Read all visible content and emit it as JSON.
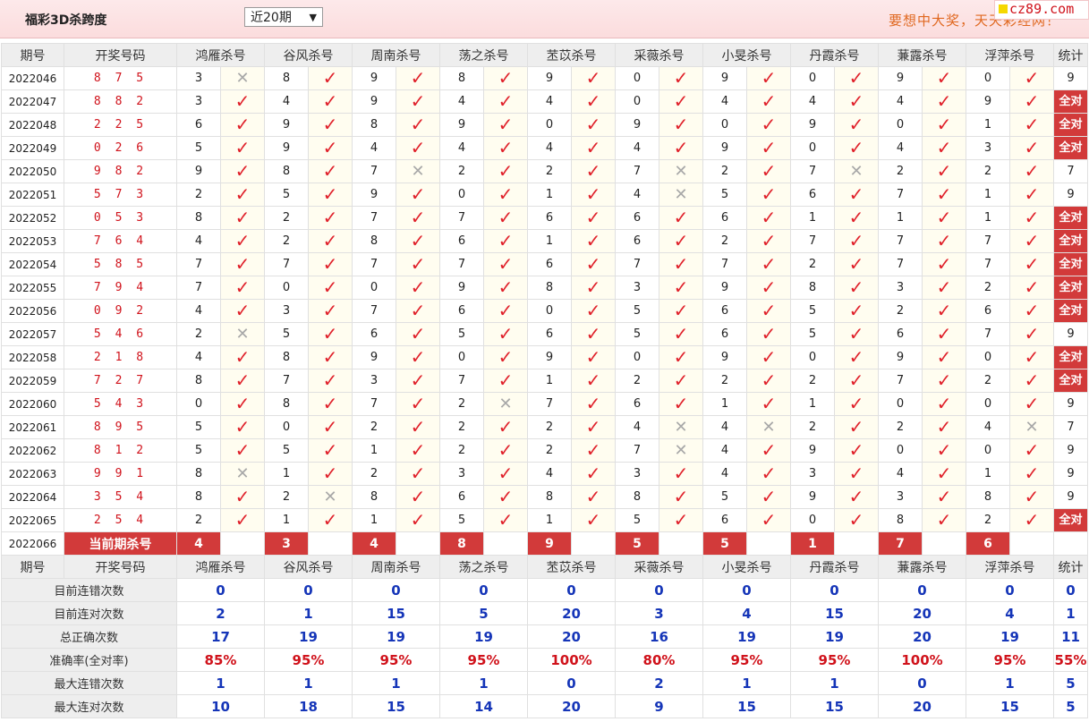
{
  "header": {
    "title": "福彩3D杀跨度",
    "period_select": "近20期",
    "dropdown_arrow": "▼",
    "slogan": "要想中大奖，天天彩经网！",
    "logo_text": "cz89.com"
  },
  "columns": {
    "issue": "期号",
    "draw": "开奖号码",
    "experts": [
      "鸿雁杀号",
      "谷风杀号",
      "周南杀号",
      "荡之杀号",
      "苤苡杀号",
      "采薇杀号",
      "小旻杀号",
      "丹霞杀号",
      "蒹露杀号",
      "浮萍杀号"
    ],
    "stat": "统计"
  },
  "marks": {
    "ok": "✓",
    "no": "✕",
    "all_ok": "全对"
  },
  "rows": [
    {
      "issue": "2022046",
      "draw": "8 7 5",
      "kills": [
        3,
        8,
        9,
        8,
        9,
        0,
        9,
        0,
        9,
        0
      ],
      "res": [
        0,
        1,
        1,
        1,
        1,
        1,
        1,
        1,
        1,
        1
      ],
      "stat": "9"
    },
    {
      "issue": "2022047",
      "draw": "8 8 2",
      "kills": [
        3,
        4,
        9,
        4,
        4,
        0,
        4,
        4,
        4,
        9
      ],
      "res": [
        1,
        1,
        1,
        1,
        1,
        1,
        1,
        1,
        1,
        1
      ],
      "stat": "全对"
    },
    {
      "issue": "2022048",
      "draw": "2 2 5",
      "kills": [
        6,
        9,
        8,
        9,
        0,
        9,
        0,
        9,
        0,
        1
      ],
      "res": [
        1,
        1,
        1,
        1,
        1,
        1,
        1,
        1,
        1,
        1
      ],
      "stat": "全对"
    },
    {
      "issue": "2022049",
      "draw": "0 2 6",
      "kills": [
        5,
        9,
        4,
        4,
        4,
        4,
        9,
        0,
        4,
        3
      ],
      "res": [
        1,
        1,
        1,
        1,
        1,
        1,
        1,
        1,
        1,
        1
      ],
      "stat": "全对"
    },
    {
      "issue": "2022050",
      "draw": "9 8 2",
      "kills": [
        9,
        8,
        7,
        2,
        2,
        7,
        2,
        7,
        2,
        2
      ],
      "res": [
        1,
        1,
        0,
        1,
        1,
        0,
        1,
        0,
        1,
        1
      ],
      "stat": "7"
    },
    {
      "issue": "2022051",
      "draw": "5 7 3",
      "kills": [
        2,
        5,
        9,
        0,
        1,
        4,
        5,
        6,
        7,
        1
      ],
      "res": [
        1,
        1,
        1,
        1,
        1,
        0,
        1,
        1,
        1,
        1
      ],
      "stat": "9"
    },
    {
      "issue": "2022052",
      "draw": "0 5 3",
      "kills": [
        8,
        2,
        7,
        7,
        6,
        6,
        6,
        1,
        1,
        1
      ],
      "res": [
        1,
        1,
        1,
        1,
        1,
        1,
        1,
        1,
        1,
        1
      ],
      "stat": "全对"
    },
    {
      "issue": "2022053",
      "draw": "7 6 4",
      "kills": [
        4,
        2,
        8,
        6,
        1,
        6,
        2,
        7,
        7,
        7
      ],
      "res": [
        1,
        1,
        1,
        1,
        1,
        1,
        1,
        1,
        1,
        1
      ],
      "stat": "全对"
    },
    {
      "issue": "2022054",
      "draw": "5 8 5",
      "kills": [
        7,
        7,
        7,
        7,
        6,
        7,
        7,
        2,
        7,
        7
      ],
      "res": [
        1,
        1,
        1,
        1,
        1,
        1,
        1,
        1,
        1,
        1
      ],
      "stat": "全对"
    },
    {
      "issue": "2022055",
      "draw": "7 9 4",
      "kills": [
        7,
        0,
        0,
        9,
        8,
        3,
        9,
        8,
        3,
        2
      ],
      "res": [
        1,
        1,
        1,
        1,
        1,
        1,
        1,
        1,
        1,
        1
      ],
      "stat": "全对"
    },
    {
      "issue": "2022056",
      "draw": "0 9 2",
      "kills": [
        4,
        3,
        7,
        6,
        0,
        5,
        6,
        5,
        2,
        6
      ],
      "res": [
        1,
        1,
        1,
        1,
        1,
        1,
        1,
        1,
        1,
        1
      ],
      "stat": "全对"
    },
    {
      "issue": "2022057",
      "draw": "5 4 6",
      "kills": [
        2,
        5,
        6,
        5,
        6,
        5,
        6,
        5,
        6,
        7
      ],
      "res": [
        0,
        1,
        1,
        1,
        1,
        1,
        1,
        1,
        1,
        1
      ],
      "stat": "9"
    },
    {
      "issue": "2022058",
      "draw": "2 1 8",
      "kills": [
        4,
        8,
        9,
        0,
        9,
        0,
        9,
        0,
        9,
        0
      ],
      "res": [
        1,
        1,
        1,
        1,
        1,
        1,
        1,
        1,
        1,
        1
      ],
      "stat": "全对"
    },
    {
      "issue": "2022059",
      "draw": "7 2 7",
      "kills": [
        8,
        7,
        3,
        7,
        1,
        2,
        2,
        2,
        7,
        2
      ],
      "res": [
        1,
        1,
        1,
        1,
        1,
        1,
        1,
        1,
        1,
        1
      ],
      "stat": "全对"
    },
    {
      "issue": "2022060",
      "draw": "5 4 3",
      "kills": [
        0,
        8,
        7,
        2,
        7,
        6,
        1,
        1,
        0,
        0
      ],
      "res": [
        1,
        1,
        1,
        0,
        1,
        1,
        1,
        1,
        1,
        1
      ],
      "stat": "9"
    },
    {
      "issue": "2022061",
      "draw": "8 9 5",
      "kills": [
        5,
        0,
        2,
        2,
        2,
        4,
        4,
        2,
        2,
        4
      ],
      "res": [
        1,
        1,
        1,
        1,
        1,
        0,
        0,
        1,
        1,
        0
      ],
      "stat": "7"
    },
    {
      "issue": "2022062",
      "draw": "8 1 2",
      "kills": [
        5,
        5,
        1,
        2,
        2,
        7,
        4,
        9,
        0,
        0
      ],
      "res": [
        1,
        1,
        1,
        1,
        1,
        0,
        1,
        1,
        1,
        1
      ],
      "stat": "9"
    },
    {
      "issue": "2022063",
      "draw": "9 9 1",
      "kills": [
        8,
        1,
        2,
        3,
        4,
        3,
        4,
        3,
        4,
        1
      ],
      "res": [
        0,
        1,
        1,
        1,
        1,
        1,
        1,
        1,
        1,
        1
      ],
      "stat": "9"
    },
    {
      "issue": "2022064",
      "draw": "3 5 4",
      "kills": [
        8,
        2,
        8,
        6,
        8,
        8,
        5,
        9,
        3,
        8
      ],
      "res": [
        1,
        0,
        1,
        1,
        1,
        1,
        1,
        1,
        1,
        1
      ],
      "stat": "9"
    },
    {
      "issue": "2022065",
      "draw": "2 5 4",
      "kills": [
        2,
        1,
        1,
        5,
        1,
        5,
        6,
        0,
        8,
        2
      ],
      "res": [
        1,
        1,
        1,
        1,
        1,
        1,
        1,
        1,
        1,
        1
      ],
      "stat": "全对"
    }
  ],
  "current": {
    "issue": "2022066",
    "label": "当前期杀号",
    "kills": [
      "4",
      "3",
      "4",
      "8",
      "9",
      "5",
      "5",
      "1",
      "7",
      "6"
    ]
  },
  "stats": [
    {
      "label": "目前连错次数",
      "values": [
        "0",
        "0",
        "0",
        "0",
        "0",
        "0",
        "0",
        "0",
        "0",
        "0"
      ],
      "total": "0",
      "pct": false
    },
    {
      "label": "目前连对次数",
      "values": [
        "2",
        "1",
        "15",
        "5",
        "20",
        "3",
        "4",
        "15",
        "20",
        "4"
      ],
      "total": "1",
      "pct": false
    },
    {
      "label": "总正确次数",
      "values": [
        "17",
        "19",
        "19",
        "19",
        "20",
        "16",
        "19",
        "19",
        "20",
        "19"
      ],
      "total": "11",
      "pct": false
    },
    {
      "label": "准确率(全对率)",
      "values": [
        "85%",
        "95%",
        "95%",
        "95%",
        "100%",
        "80%",
        "95%",
        "95%",
        "100%",
        "95%"
      ],
      "total": "55%",
      "pct": true
    },
    {
      "label": "最大连错次数",
      "values": [
        "1",
        "1",
        "1",
        "1",
        "0",
        "2",
        "1",
        "1",
        "0",
        "1"
      ],
      "total": "5",
      "pct": false
    },
    {
      "label": "最大连对次数",
      "values": [
        "10",
        "18",
        "15",
        "14",
        "20",
        "9",
        "15",
        "15",
        "20",
        "15"
      ],
      "total": "5",
      "pct": false
    }
  ]
}
